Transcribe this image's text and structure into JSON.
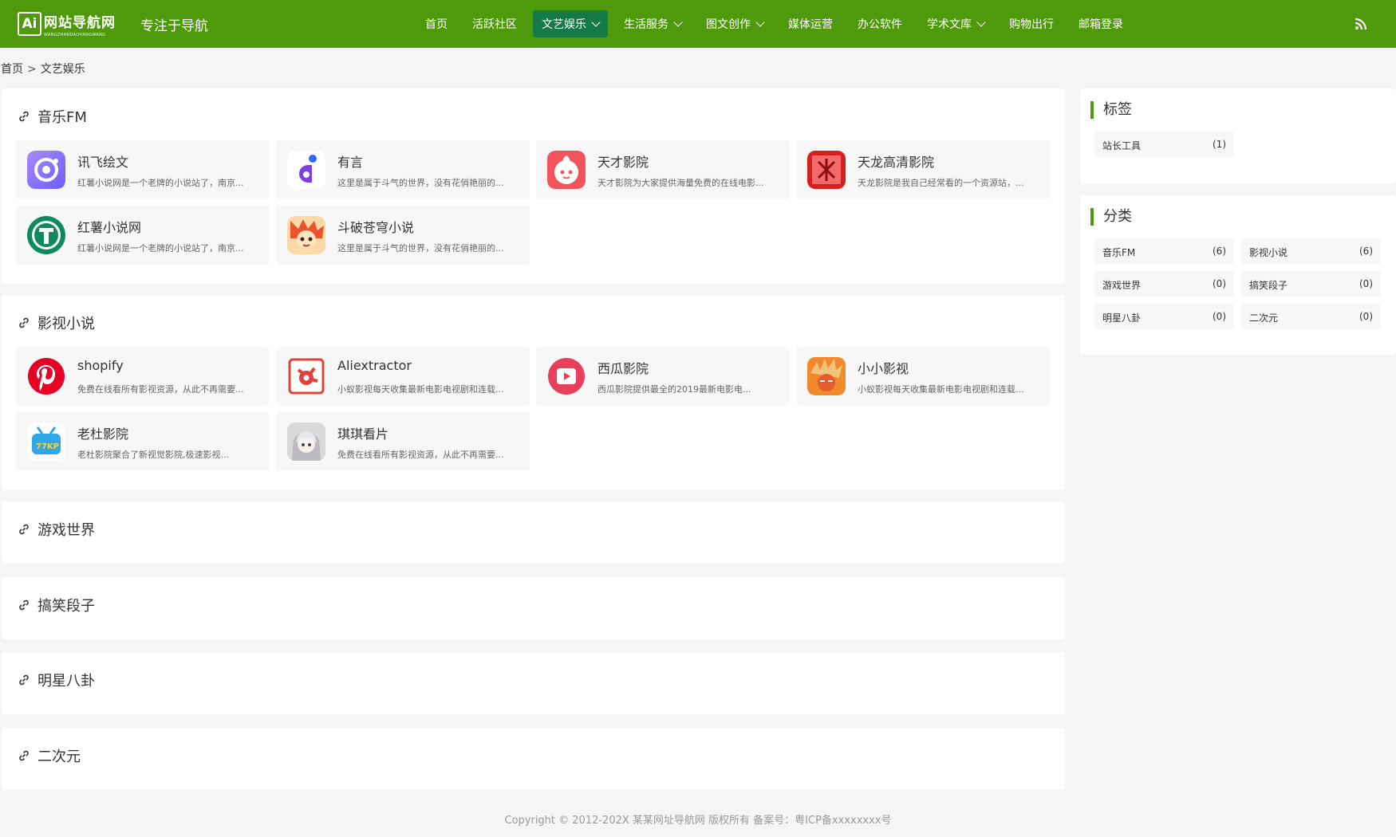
{
  "header": {
    "logo_text": "网站导航网",
    "logo_sub": "WANGZHANDAOHANGWANG",
    "logo_badge": "Ai",
    "tagline": "专注于导航",
    "nav": [
      {
        "label": "首页",
        "dropdown": false,
        "active": false
      },
      {
        "label": "活跃社区",
        "dropdown": false,
        "active": false
      },
      {
        "label": "文艺娱乐",
        "dropdown": true,
        "active": true
      },
      {
        "label": "生活服务",
        "dropdown": true,
        "active": false
      },
      {
        "label": "图文创作",
        "dropdown": true,
        "active": false
      },
      {
        "label": "媒体运营",
        "dropdown": false,
        "active": false
      },
      {
        "label": "办公软件",
        "dropdown": false,
        "active": false
      },
      {
        "label": "学术文库",
        "dropdown": true,
        "active": false
      },
      {
        "label": "购物出行",
        "dropdown": false,
        "active": false
      },
      {
        "label": "邮箱登录",
        "dropdown": false,
        "active": false
      }
    ],
    "rss_icon": "rss-icon"
  },
  "breadcrumb": {
    "home": "首页",
    "separator": ">",
    "current": "文艺娱乐"
  },
  "sections": [
    {
      "title": "音乐FM",
      "items": [
        {
          "name": "讯飞绘文",
          "desc": "红薯小说网是一个老牌的小说站了，南京...",
          "icon": "xunfei-icon"
        },
        {
          "name": "有言",
          "desc": "这里是属于斗气的世界，没有花俏艳丽的...",
          "icon": "youyan-icon"
        },
        {
          "name": "天才影院",
          "desc": "天才影院为大家提供海量免费的在线电影...",
          "icon": "tiancai-icon"
        },
        {
          "name": "天龙高清影院",
          "desc": "天龙影院是我自己经常看的一个资源站，...",
          "icon": "tianlong-icon"
        },
        {
          "name": "红薯小说网",
          "desc": "红薯小说网是一个老牌的小说站了，南京...",
          "icon": "hongshu-icon"
        },
        {
          "name": "斗破苍穹小说",
          "desc": "这里是属于斗气的世界，没有花俏艳丽的...",
          "icon": "doupo-icon"
        }
      ]
    },
    {
      "title": "影视小说",
      "items": [
        {
          "name": "shopify",
          "desc": "免费在线看所有影视资源，从此不再需要...",
          "icon": "pinterest-icon"
        },
        {
          "name": "Aliextractor",
          "desc": "小蚁影视每天收集最新电影电视剧和连载...",
          "icon": "aliextractor-icon"
        },
        {
          "name": "西瓜影院",
          "desc": "西瓜影院提供最全的2019最新电影电...",
          "icon": "xigua-icon"
        },
        {
          "name": "小小影视",
          "desc": "小蚁影视每天收集最新电影电视剧和连载...",
          "icon": "xiaoxiao-icon"
        },
        {
          "name": "老杜影院",
          "desc": "老杜影院聚合了新视觉影院,极速影视...",
          "icon": "laodu-icon"
        },
        {
          "name": "琪琪看片",
          "desc": "免费在线看所有影视资源，从此不再需要...",
          "icon": "qiqi-icon"
        }
      ]
    },
    {
      "title": "游戏世界",
      "items": []
    },
    {
      "title": "搞笑段子",
      "items": []
    },
    {
      "title": "明星八卦",
      "items": []
    },
    {
      "title": "二次元",
      "items": []
    }
  ],
  "sidebar": {
    "tags_title": "标签",
    "tags": [
      {
        "label": "站长工具",
        "count": "(1)"
      }
    ],
    "cats_title": "分类",
    "cats": [
      {
        "label": "音乐FM",
        "count": "(6)"
      },
      {
        "label": "影视小说",
        "count": "(6)"
      },
      {
        "label": "游戏世界",
        "count": "(0)"
      },
      {
        "label": "搞笑段子",
        "count": "(0)"
      },
      {
        "label": "明星八卦",
        "count": "(0)"
      },
      {
        "label": "二次元",
        "count": "(0)"
      }
    ]
  },
  "footer": {
    "copyright": "Copyright © 2012-202X 某某网址导航网 版权所有 备案号：粤ICP备xxxxxxxx号"
  },
  "colors": {
    "brand": "#4f9a0c",
    "nav_active": "#167a48"
  }
}
